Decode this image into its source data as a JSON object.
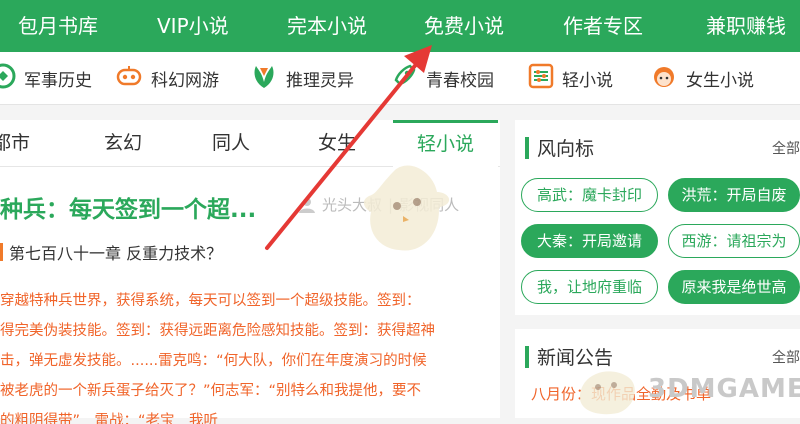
{
  "top_nav": [
    "包月书库",
    "VIP小说",
    "完本小说",
    "免费小说",
    "作者专区",
    "兼职赚钱"
  ],
  "categories": [
    {
      "label": "军事历史",
      "icon": "military-icon"
    },
    {
      "label": "科幻网游",
      "icon": "gamepad-icon"
    },
    {
      "label": "推理灵异",
      "icon": "leaf-icon"
    },
    {
      "label": "青春校园",
      "icon": "rocket-icon"
    },
    {
      "label": "轻小说",
      "icon": "sliders-icon"
    },
    {
      "label": "女生小说",
      "icon": "girl-icon"
    }
  ],
  "tabs": [
    "都市",
    "玄幻",
    "同人",
    "女生",
    "轻小说"
  ],
  "active_tab": "轻小说",
  "featured": {
    "title": "种兵：每天签到一个超...",
    "author": "光头大叔",
    "genre": "影视同人",
    "chapter": "第七百八十一章 反重力技术？",
    "desc_lines": [
      "穿越特种兵世界，获得系统，每天可以签到一个超级技能。签到：",
      "得完美伪装技能。签到：获得远距离危险感知技能。签到：获得超神",
      "击，弹无虚发技能。......雷克鸣：“何大队，你们在年度演习的时候",
      "被老虎的一个新兵蛋子给灭了？”何志军：“别特么和我提他，要不",
      "的粗阴得带”　雷战：“老宝　我听"
    ]
  },
  "trend": {
    "title": "风向标",
    "all": "全部",
    "tags": [
      {
        "label": "高武：魔卡封印",
        "filled": false
      },
      {
        "label": "洪荒：开局自废",
        "filled": true
      },
      {
        "label": "大秦：开局邀请",
        "filled": true
      },
      {
        "label": "西游：请祖宗为",
        "filled": false
      },
      {
        "label": "我，让地府重临",
        "filled": false
      },
      {
        "label": "原来我是绝世高",
        "filled": true
      }
    ]
  },
  "news": {
    "title": "新闻公告",
    "all": "全部",
    "items": [
      "八月份：现作品全勤及书单"
    ]
  },
  "watermark": "3DMGAME",
  "colors": {
    "brand": "#2ba85b",
    "accent": "#f0642a",
    "arrow": "#e53935"
  }
}
